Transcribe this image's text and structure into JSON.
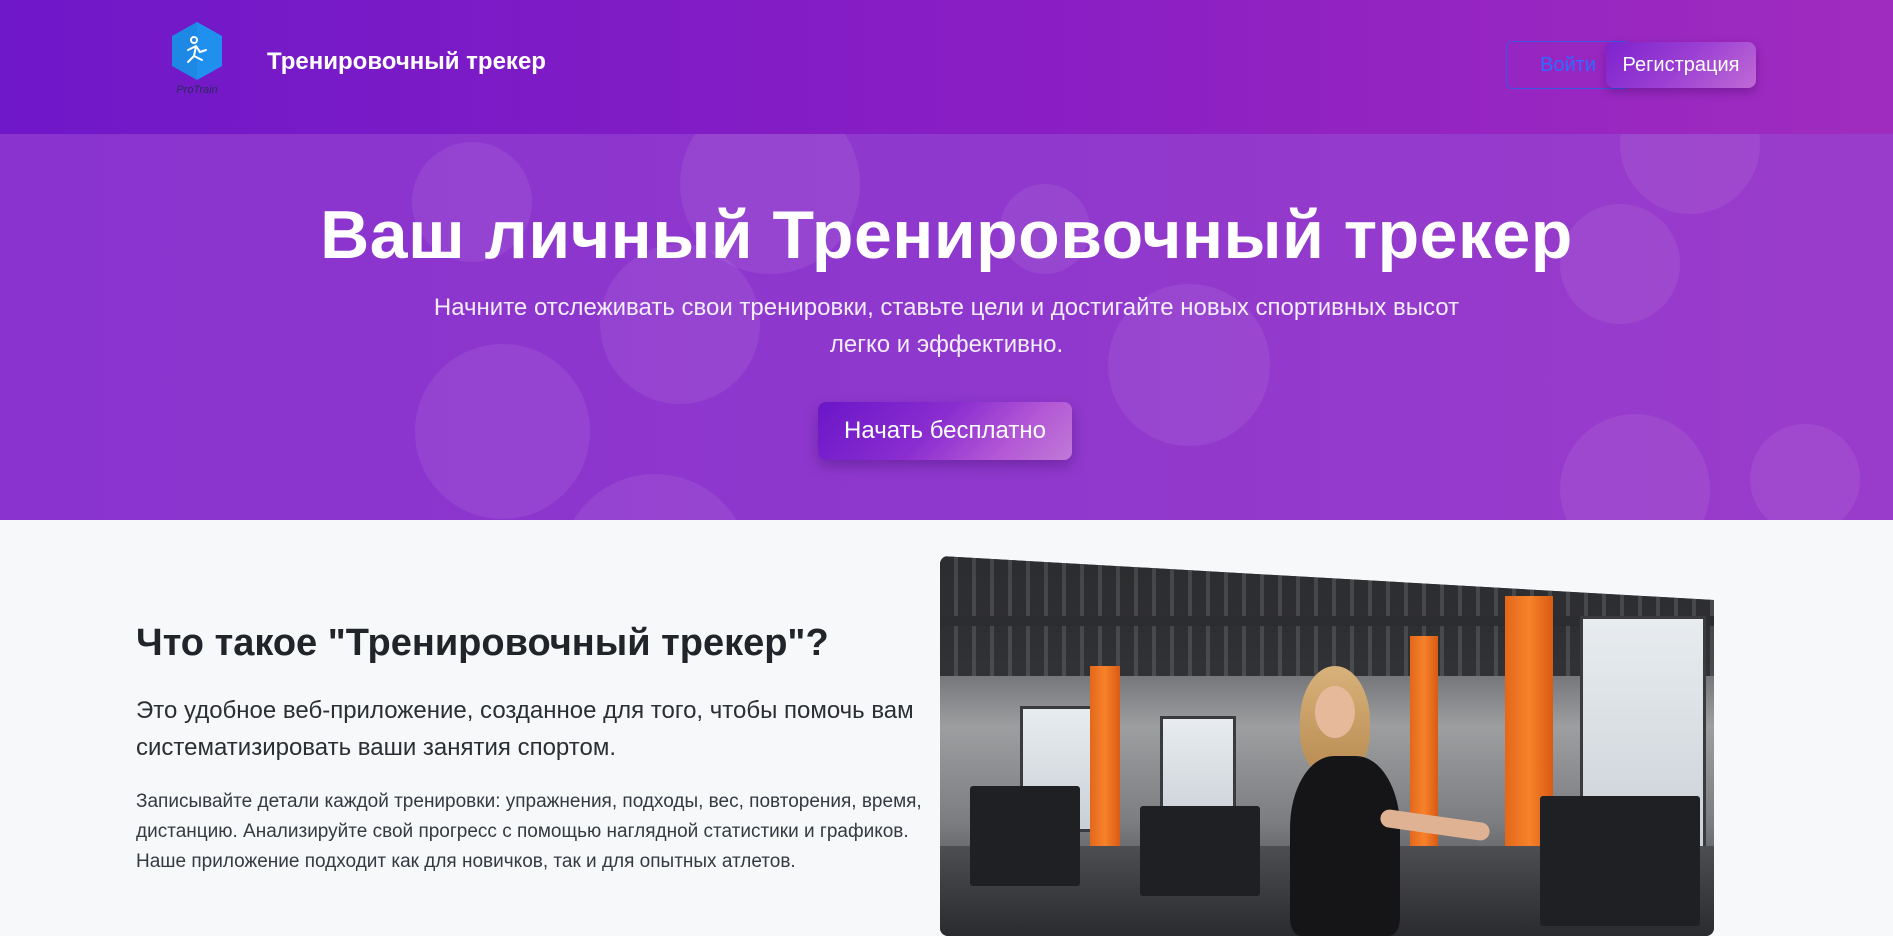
{
  "header": {
    "logo_text": "ProTrain",
    "brand_title": "Тренировочный трекер",
    "login_label": "Войти",
    "register_label": "Регистрация"
  },
  "hero": {
    "title": "Ваш личный Тренировочный трекер",
    "subtitle": "Начните отслеживать свои тренировки, ставьте цели и достигайте новых спортивных высот легко и эффективно.",
    "cta_label": "Начать бесплатно"
  },
  "about": {
    "title": "Что такое \"Тренировочный трекер\"?",
    "lead": "Это удобное веб-приложение, созданное для того, чтобы помочь вам систематизировать ваши занятия спортом.",
    "text": "Записывайте детали каждой тренировки: упражнения, подходы, вес, повторения, время, дистанцию. Анализируйте свой прогресс с помощью наглядной статистики и графиков. Наше приложение подходит как для новичков, так и для опытных атлетов."
  },
  "colors": {
    "header_gradient_start": "#6f18c9",
    "header_gradient_end": "#a02cbf",
    "hero_background": "#8f38cd",
    "login_border": "#3f55e8",
    "login_text": "#2f6bff",
    "logo_hex": "#1e88e5",
    "page_background": "#f7f8fa"
  },
  "icons": {
    "logo": "runner-hexagon-icon"
  }
}
